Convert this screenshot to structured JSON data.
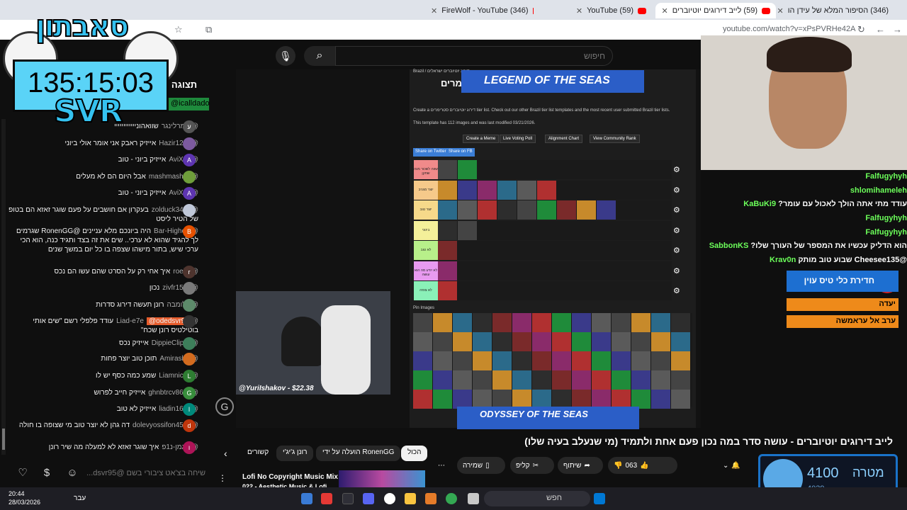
{
  "browser": {
    "tabs": [
      {
        "title": "(346) הסיפור המלא של עידן הו",
        "active": false
      },
      {
        "title": "(59) לייב דירוגים יוטיוברים",
        "active": true
      },
      {
        "title": "(59) YouTube",
        "active": false
      },
      {
        "title": "(346) FireWolf - YouTube",
        "active": false
      }
    ],
    "url": "youtube.com/watch?v=xPsPVRHe42A"
  },
  "overlay": {
    "logo_text": "סאבתון",
    "timer": "135:15:03",
    "svr": "SVR"
  },
  "chat": {
    "header": "תצוגה ב",
    "pinned_chip": "@icalldado",
    "messages": [
      {
        "author": "@עומרלינגר",
        "text": "שוואהוניייייייייייי",
        "avatar": "ע",
        "color": "#555555"
      },
      {
        "author": "@Hazir1234",
        "text": "אייזיק ראבק אני אומר אולי ביוני",
        "avatar": "",
        "color": "#7c5a9e"
      },
      {
        "author": "@AviXoe",
        "text": "אייזיק ביוני - טוב",
        "avatar": "A",
        "color": "#5e35b1"
      },
      {
        "author": "@mashmashon",
        "text": "אבל היום הם לא מעלים",
        "avatar": "",
        "color": "#6f9e3b"
      },
      {
        "author": "@AviXoe",
        "text": "אייזיק ביוני - טוב",
        "avatar": "A",
        "color": "#5e35b1"
      },
      {
        "author": "@zolduck3436",
        "text": "בעקרון אם חושבים על פעם שוגר זאזא הם בטופ של הטיר ליסט",
        "avatar": "",
        "color": "#c0c8d8"
      },
      {
        "author": "@Bar-Highest",
        "text": "היה ביונכם מלא עניינים @RonenGG שגרמים לך להגיד שהוא לא ערכי.. שים את זה בצד ותגיד כנה, הוא הכי ערכי שיש, בתור מישהו שצפה בו כל יום במשך שנים",
        "avatar": "B",
        "color": "#e65100"
      },
      {
        "author": "@roei-3",
        "text": "איך אחי רק על הסרט שהם עשו הם נכס",
        "avatar": "r",
        "color": "#4e342e"
      },
      {
        "author": "@zivfr1535",
        "text": "נכון",
        "avatar": "",
        "color": "#7a7a7a"
      },
      {
        "author": "@שלומבה",
        "text": "רונן תעשה דירוג סדרות",
        "avatar": "",
        "color": "#5d8a6a"
      },
      {
        "author": "@Liad-e7e",
        "text": "עודד פלפלי רשם \"שים אותי בוטילטיס רונן שכח\"",
        "avatar": "",
        "color": "#333333",
        "chip": "@odedsvr95"
      },
      {
        "author": "@DippieClipps",
        "text": "אייזיק נכס",
        "avatar": "",
        "color": "#3d7e5a"
      },
      {
        "author": "@Amirashty",
        "text": "תוכן טוב יוצר פחות",
        "avatar": "",
        "color": "#d36b1f"
      },
      {
        "author": "@Liamnic12",
        "text": "שמע כמה כסף יש לו",
        "avatar": "L",
        "color": "#2e7d32"
      },
      {
        "author": "@ghnbtrcv8672",
        "text": "אייזיק חייב לפרוש",
        "avatar": "G",
        "color": "#388e3c"
      },
      {
        "author": "@liadin1673",
        "text": "אייזיק לא טוב",
        "avatar": "l",
        "color": "#00897b"
      },
      {
        "author": "@dolevyossifon4541",
        "text": "דה גהן לא יוצר טוב מי שצופה בו חולה",
        "avatar": "d",
        "color": "#bf360c"
      },
      {
        "author": "@הוגמן-נ1פ",
        "text": "איך שוגר זאזא לא למעלה מה שיר רונן",
        "avatar": "ו",
        "color": "#ad1457"
      }
    ],
    "input_placeholder": "שיחה בצ'אט ציבורי בשם @dsvr95..."
  },
  "youtube": {
    "search_placeholder": "חיפוש",
    "video_title": "לייב דירוגים יוטיוברים - עושה סדר במה נכון פעם אחת ולתמיד (מי שנעלב בעיה שלו)",
    "chips": [
      "הכול",
      "הועלה על ידי RonenGG",
      "רונן ג'יג'י",
      "קשורים"
    ],
    "actions": {
      "like": "063",
      "share": "שיתוף",
      "clip": "קליפ",
      "save": "שמירה"
    },
    "suggestion": {
      "title": "Lofi No Copyright Music Mix",
      "sub": "022 - Aesthetic Music & Lofi"
    }
  },
  "tierlist": {
    "breadcrumb": "Brazil / דירוג יוטיוברים ישראלים",
    "heading": "ם סטרימרים",
    "line1": "Create a דירוג יוטיוברים סטרימרים tier list. Check out our other Brazil tier list templates and the most recent user submitted Brazil tier lists.",
    "line2": "This template has 112 images and was last modified 03/21/2026.",
    "buttons": [
      "Create a Meme",
      "Live Voting Poll",
      "Alignment Chart",
      "View Community Rank"
    ],
    "share": [
      "Share on Twitter",
      "Share on FB"
    ],
    "pin_label": "Pin Images",
    "ad_top": "LEGEND OF THE SEAS",
    "ad_bottom": "ODYSSEY OF THE SEAS",
    "tiers": [
      {
        "label": "שווה לשכור מגה שחקן",
        "color": "#f08a8a"
      },
      {
        "label": "יוצר מגניב",
        "color": "#f6c98a"
      },
      {
        "label": "יוצר טוב",
        "color": "#f6d98a"
      },
      {
        "label": "בינוני",
        "color": "#f4f09a"
      },
      {
        "label": "לא טוב",
        "color": "#b8f08a"
      },
      {
        "label": "לא יודע מה הוא עושה",
        "color": "#e89af0"
      },
      {
        "label": "לא צופה",
        "color": "#8af0b8"
      }
    ]
  },
  "stream": {
    "cam_label": "@YuriIshakov - $22.38",
    "twitch_chat": [
      {
        "user": "Falfugyhyh",
        "text": ""
      },
      {
        "user": "shlomihameleh",
        "text": ""
      },
      {
        "user": "KaBuKi9",
        "text": "עודד מתי אתה הולך לאכול עם עומר?"
      },
      {
        "user": "Falfugyhyh",
        "text": ""
      },
      {
        "user": "Falfugyhyh",
        "text": ""
      },
      {
        "user": "SabbonKS",
        "text": "הוא הדליק עכשיו את המספר של העורך שלו?"
      },
      {
        "user": "Krav0n",
        "text": "@Cheesee135 שבוע טוב מותק"
      }
    ],
    "widget_title": "חדירת כלי טיס עוין",
    "widget_rows": [
      "יעדה",
      "ערב אל עראמשה"
    ],
    "goal": {
      "label": "מטרה",
      "value": "4100",
      "current": "4039"
    }
  },
  "taskbar": {
    "time": "20:44",
    "date": "28/03/2026",
    "lang": "עבר",
    "search": "חפש"
  }
}
